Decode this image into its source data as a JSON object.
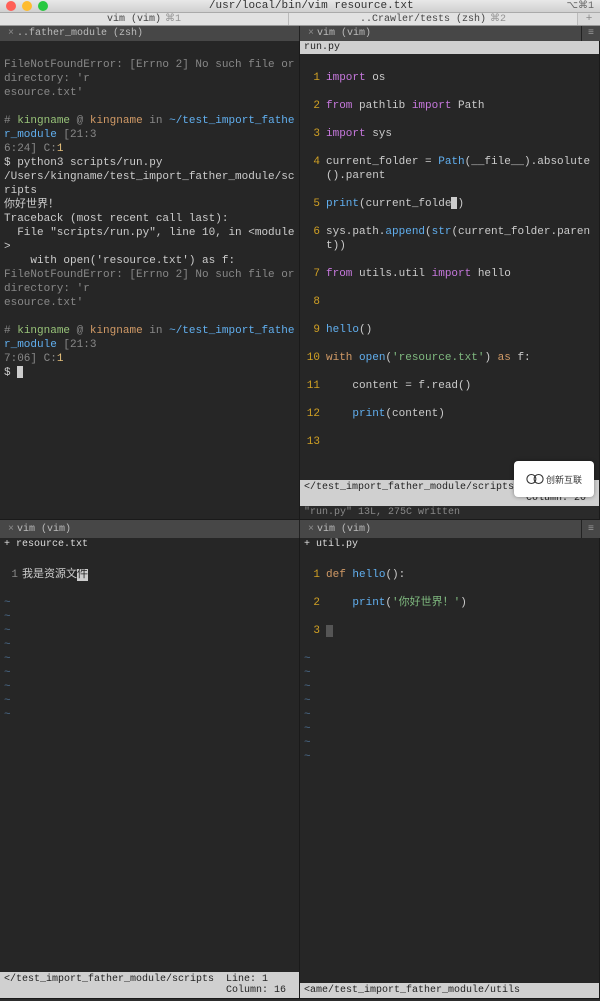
{
  "title": "/usr/local/bin/vim resource.txt",
  "title_right": "⌥⌘1",
  "main_tabs": {
    "left": "vim (vim)",
    "right": "..Crawler/tests (zsh)",
    "count_left": "⌘1",
    "count_right": "⌘2",
    "plus": "+"
  },
  "inner_tabs": {
    "tl": "..father_module (zsh)",
    "tr": "vim (vim)"
  },
  "pane_tl": {
    "lines": [
      "FileNotFoundError: [Errno 2] No such file or directory: 'resource.txt'",
      "",
      "# kingname @ kingname in ~/test_import_father_module [21:36:24] C:1",
      "$ python3 scripts/run.py",
      "/Users/kingname/test_import_father_module/scripts",
      "你好世界！",
      "Traceback (most recent call last):",
      "  File \"scripts/run.py\", line 10, in <module>",
      "    with open('resource.txt') as f:",
      "FileNotFoundError: [Errno 2] No such file or directory: 'resource.txt'",
      "",
      "# kingname @ kingname in ~/test_import_father_module [21:37:06] C:1",
      "$ "
    ]
  },
  "pane_tr": {
    "filename": "run.py",
    "code": [
      {
        "n": 1,
        "t": "import os"
      },
      {
        "n": 2,
        "t": "from pathlib import Path"
      },
      {
        "n": 3,
        "t": "import sys"
      },
      {
        "n": 4,
        "t": "current_folder = Path(__file__).absolute().parent"
      },
      {
        "n": 5,
        "t": "print(current_folder)"
      },
      {
        "n": 6,
        "t": "sys.path.append(str(current_folder.parent))"
      },
      {
        "n": 7,
        "t": "from utils.util import hello"
      },
      {
        "n": 8,
        "t": ""
      },
      {
        "n": 9,
        "t": "hello()"
      },
      {
        "n": 10,
        "t": "with open('resource.txt') as f:"
      },
      {
        "n": 11,
        "t": "    content = f.read()"
      },
      {
        "n": 12,
        "t": "    print(content)"
      },
      {
        "n": 13,
        "t": ""
      }
    ],
    "status_path": "</test_import_father_module/scripts",
    "status_pos": "Line:  5  Column: 20",
    "below": "\"run.py\" 13L, 275C written"
  },
  "pane_bl": {
    "filename": "+ resource.txt",
    "code": [
      {
        "n": 1,
        "t": "我是资源文"
      }
    ],
    "status_path": "</test_import_father_module/scripts",
    "status_pos": "Line:  1  Column: 16"
  },
  "pane_br": {
    "filename": "+ util.py",
    "code": [
      {
        "n": 1,
        "t": "def hello():"
      },
      {
        "n": 2,
        "t": "    print('你好世界！')"
      },
      {
        "n": 3,
        "t": ""
      }
    ],
    "status_path": "<ame/test_import_father_module/utils"
  },
  "inner_tabs2": {
    "left": "vim (vim)",
    "right": "vim (vim)"
  },
  "watermark": "创新互联"
}
